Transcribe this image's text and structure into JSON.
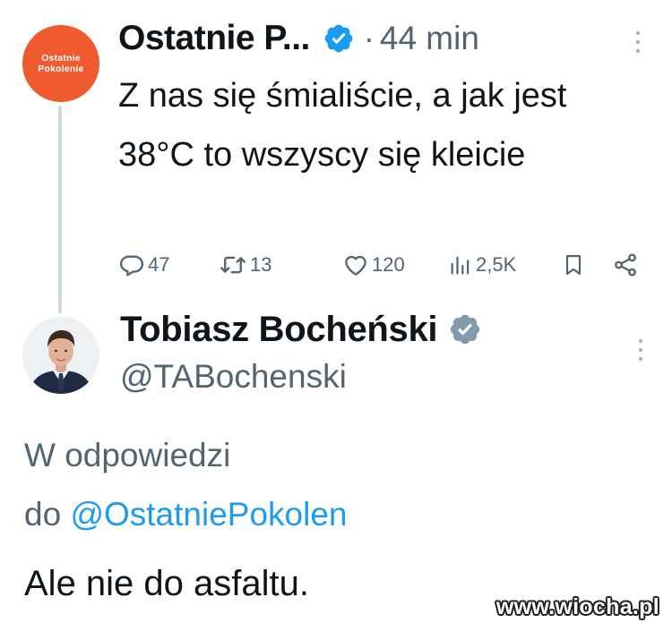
{
  "theme": {
    "accent": "#1d9bf0",
    "muted_text": "#536471",
    "text": "#0f1419",
    "org_avatar_bg": "#ef5a2e",
    "verified_grey": "#829aab"
  },
  "original_tweet": {
    "avatar": {
      "icon": "ostatnie-pokolenie-logo",
      "logo_line_1": "Ostatnie",
      "logo_line_2": "Pokolenie"
    },
    "author_name": "Ostatnie P...",
    "verified_badge": "verified-blue-icon",
    "time_separator": "·",
    "time": "44 min",
    "text": "Z nas się śmialiście, a jak jest 38°C to wszyscy się kleicie",
    "actions": {
      "replies": "47",
      "reposts": "13",
      "likes": "120",
      "views": "2,5K"
    }
  },
  "reply_tweet": {
    "author_name": "Tobiasz Bocheński",
    "verified_badge": "verified-grey-icon",
    "handle": "@TABochenski",
    "reply_context_line_1": "W odpowiedzi",
    "reply_context_prefix": "do ",
    "reply_context_mention": "@OstatniePokolen",
    "text": "Ale nie do asfaltu."
  },
  "watermark": "www.wiocha.pl"
}
